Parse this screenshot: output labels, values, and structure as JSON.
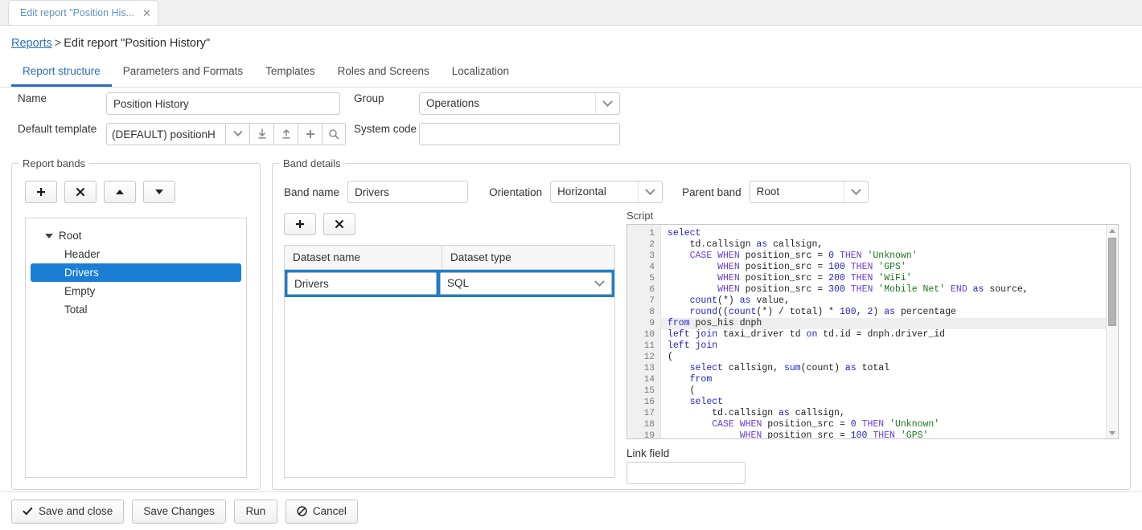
{
  "browser": {
    "tab_title": "Edit report \"Position His...",
    "close_icon": "close-icon"
  },
  "breadcrumb": {
    "root_link": "Reports",
    "separator": ">",
    "current": "Edit report \"Position History\""
  },
  "tabs": [
    {
      "label": "Report structure",
      "active": true
    },
    {
      "label": "Parameters and Formats",
      "active": false
    },
    {
      "label": "Templates",
      "active": false
    },
    {
      "label": "Roles and Screens",
      "active": false
    },
    {
      "label": "Localization",
      "active": false
    }
  ],
  "form": {
    "name_label": "Name",
    "name_value": "Position History",
    "group_label": "Group",
    "group_value": "Operations",
    "default_template_label": "Default template",
    "default_template_value": "(DEFAULT) positionH",
    "system_code_label": "System code",
    "system_code_value": "",
    "system_code_placeholder": ""
  },
  "bands_panel": {
    "legend": "Report bands",
    "toolbar": [
      {
        "name": "add-band-button",
        "glyph": "+"
      },
      {
        "name": "delete-band-button",
        "glyph": "✖"
      },
      {
        "name": "move-band-up-button",
        "glyph": "▲"
      },
      {
        "name": "move-band-down-button",
        "glyph": "▼"
      }
    ],
    "tree": [
      {
        "label": "Root",
        "level": 0,
        "selected": false,
        "expanded": true
      },
      {
        "label": "Header",
        "level": 1,
        "selected": false
      },
      {
        "label": "Drivers",
        "level": 1,
        "selected": true
      },
      {
        "label": "Empty",
        "level": 1,
        "selected": false
      },
      {
        "label": "Total",
        "level": 1,
        "selected": false
      }
    ]
  },
  "details_panel": {
    "legend": "Band details",
    "band_name_label": "Band name",
    "band_name_value": "Drivers",
    "orientation_label": "Orientation",
    "orientation_value": "Horizontal",
    "parent_band_label": "Parent band",
    "parent_band_value": "Root",
    "toolbar": [
      {
        "name": "add-dataset-button",
        "glyph": "+"
      },
      {
        "name": "delete-dataset-button",
        "glyph": "✖"
      }
    ],
    "dataset_table": {
      "columns": [
        "Dataset name",
        "Dataset type"
      ],
      "rows": [
        {
          "name": "Drivers",
          "type": "SQL",
          "selected": true
        }
      ]
    },
    "script_label": "Script",
    "link_field_label": "Link field",
    "link_field_value": "",
    "script_lines": [
      {
        "n": 1,
        "highlighted": false,
        "tokens": [
          {
            "t": "select",
            "c": "kw"
          }
        ]
      },
      {
        "n": 2,
        "highlighted": false,
        "tokens": [
          {
            "t": "    td.callsign ",
            "c": ""
          },
          {
            "t": "as",
            "c": "kw"
          },
          {
            "t": " callsign,",
            "c": ""
          }
        ]
      },
      {
        "n": 3,
        "highlighted": false,
        "tokens": [
          {
            "t": "    ",
            "c": ""
          },
          {
            "t": "CASE",
            "c": "kw2"
          },
          {
            "t": " ",
            "c": ""
          },
          {
            "t": "WHEN",
            "c": "kw2"
          },
          {
            "t": " position_src = ",
            "c": ""
          },
          {
            "t": "0",
            "c": "num"
          },
          {
            "t": " ",
            "c": ""
          },
          {
            "t": "THEN",
            "c": "kw2"
          },
          {
            "t": " ",
            "c": ""
          },
          {
            "t": "'Unknown'",
            "c": "str"
          }
        ]
      },
      {
        "n": 4,
        "highlighted": false,
        "tokens": [
          {
            "t": "         ",
            "c": ""
          },
          {
            "t": "WHEN",
            "c": "kw2"
          },
          {
            "t": " position_src = ",
            "c": ""
          },
          {
            "t": "100",
            "c": "num"
          },
          {
            "t": " ",
            "c": ""
          },
          {
            "t": "THEN",
            "c": "kw2"
          },
          {
            "t": " ",
            "c": ""
          },
          {
            "t": "'GPS'",
            "c": "str"
          }
        ]
      },
      {
        "n": 5,
        "highlighted": false,
        "tokens": [
          {
            "t": "         ",
            "c": ""
          },
          {
            "t": "WHEN",
            "c": "kw2"
          },
          {
            "t": " position_src = ",
            "c": ""
          },
          {
            "t": "200",
            "c": "num"
          },
          {
            "t": " ",
            "c": ""
          },
          {
            "t": "THEN",
            "c": "kw2"
          },
          {
            "t": " ",
            "c": ""
          },
          {
            "t": "'WiFi'",
            "c": "str"
          }
        ]
      },
      {
        "n": 6,
        "highlighted": false,
        "tokens": [
          {
            "t": "         ",
            "c": ""
          },
          {
            "t": "WHEN",
            "c": "kw2"
          },
          {
            "t": " position_src = ",
            "c": ""
          },
          {
            "t": "300",
            "c": "num"
          },
          {
            "t": " ",
            "c": ""
          },
          {
            "t": "THEN",
            "c": "kw2"
          },
          {
            "t": " ",
            "c": ""
          },
          {
            "t": "'Mobile Net'",
            "c": "str"
          },
          {
            "t": " ",
            "c": ""
          },
          {
            "t": "END",
            "c": "kw2"
          },
          {
            "t": " ",
            "c": ""
          },
          {
            "t": "as",
            "c": "kw"
          },
          {
            "t": " source,",
            "c": ""
          }
        ]
      },
      {
        "n": 7,
        "highlighted": false,
        "tokens": [
          {
            "t": "    ",
            "c": ""
          },
          {
            "t": "count",
            "c": "kw"
          },
          {
            "t": "(*) ",
            "c": ""
          },
          {
            "t": "as",
            "c": "kw"
          },
          {
            "t": " value,",
            "c": ""
          }
        ]
      },
      {
        "n": 8,
        "highlighted": false,
        "tokens": [
          {
            "t": "    ",
            "c": ""
          },
          {
            "t": "round",
            "c": "kw"
          },
          {
            "t": "((",
            "c": ""
          },
          {
            "t": "count",
            "c": "kw"
          },
          {
            "t": "(*) / total) * ",
            "c": ""
          },
          {
            "t": "100",
            "c": "num"
          },
          {
            "t": ", ",
            "c": ""
          },
          {
            "t": "2",
            "c": "num"
          },
          {
            "t": ") ",
            "c": ""
          },
          {
            "t": "as",
            "c": "kw"
          },
          {
            "t": " percentage",
            "c": ""
          }
        ]
      },
      {
        "n": 9,
        "highlighted": true,
        "tokens": [
          {
            "t": "from",
            "c": "kw"
          },
          {
            "t": " pos_his dnph",
            "c": ""
          }
        ]
      },
      {
        "n": 10,
        "highlighted": false,
        "tokens": [
          {
            "t": "left",
            "c": "kw"
          },
          {
            "t": " ",
            "c": ""
          },
          {
            "t": "join",
            "c": "kw"
          },
          {
            "t": " taxi_driver td ",
            "c": ""
          },
          {
            "t": "on",
            "c": "kw"
          },
          {
            "t": " td.id = dnph.driver_id",
            "c": ""
          }
        ]
      },
      {
        "n": 11,
        "highlighted": false,
        "tokens": [
          {
            "t": "left",
            "c": "kw"
          },
          {
            "t": " ",
            "c": ""
          },
          {
            "t": "join",
            "c": "kw"
          }
        ]
      },
      {
        "n": 12,
        "highlighted": false,
        "tokens": [
          {
            "t": "(",
            "c": ""
          }
        ]
      },
      {
        "n": 13,
        "highlighted": false,
        "tokens": [
          {
            "t": "    ",
            "c": ""
          },
          {
            "t": "select",
            "c": "kw"
          },
          {
            "t": " callsign, ",
            "c": ""
          },
          {
            "t": "sum",
            "c": "kw"
          },
          {
            "t": "(count) ",
            "c": ""
          },
          {
            "t": "as",
            "c": "kw"
          },
          {
            "t": " total",
            "c": ""
          }
        ]
      },
      {
        "n": 14,
        "highlighted": false,
        "tokens": [
          {
            "t": "    ",
            "c": ""
          },
          {
            "t": "from",
            "c": "kw"
          }
        ]
      },
      {
        "n": 15,
        "highlighted": false,
        "tokens": [
          {
            "t": "    (",
            "c": ""
          }
        ]
      },
      {
        "n": 16,
        "highlighted": false,
        "tokens": [
          {
            "t": "    ",
            "c": ""
          },
          {
            "t": "select",
            "c": "kw"
          }
        ]
      },
      {
        "n": 17,
        "highlighted": false,
        "tokens": [
          {
            "t": "        td.callsign ",
            "c": ""
          },
          {
            "t": "as",
            "c": "kw"
          },
          {
            "t": " callsign,",
            "c": ""
          }
        ]
      },
      {
        "n": 18,
        "highlighted": false,
        "tokens": [
          {
            "t": "        ",
            "c": ""
          },
          {
            "t": "CASE",
            "c": "kw2"
          },
          {
            "t": " ",
            "c": ""
          },
          {
            "t": "WHEN",
            "c": "kw2"
          },
          {
            "t": " position_src = ",
            "c": ""
          },
          {
            "t": "0",
            "c": "num"
          },
          {
            "t": " ",
            "c": ""
          },
          {
            "t": "THEN",
            "c": "kw2"
          },
          {
            "t": " ",
            "c": ""
          },
          {
            "t": "'Unknown'",
            "c": "str"
          }
        ]
      },
      {
        "n": 19,
        "highlighted": false,
        "tokens": [
          {
            "t": "             ",
            "c": ""
          },
          {
            "t": "WHEN",
            "c": "kw2"
          },
          {
            "t": " position src = ",
            "c": ""
          },
          {
            "t": "100",
            "c": "num"
          },
          {
            "t": " ",
            "c": ""
          },
          {
            "t": "THEN",
            "c": "kw2"
          },
          {
            "t": " ",
            "c": ""
          },
          {
            "t": "'GPS'",
            "c": "str"
          }
        ]
      }
    ]
  },
  "footer": {
    "save_and_close": "Save and close",
    "save_changes": "Save Changes",
    "run": "Run",
    "cancel": "Cancel"
  },
  "colors": {
    "accent": "#2a6ebb",
    "selection": "#1a7fd4",
    "link": "#2a6ebb",
    "keyword": "#2222cc",
    "string": "#1a7a1a"
  }
}
